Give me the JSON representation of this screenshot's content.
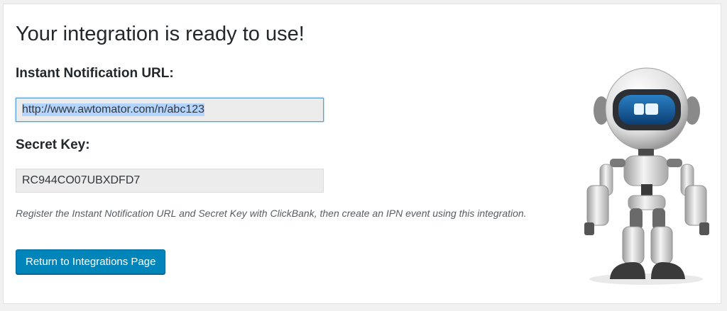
{
  "page": {
    "title": "Your integration is ready to use!"
  },
  "fields": {
    "notification_url": {
      "label": "Instant Notification URL:",
      "value": "http://www.awtomator.com/n/abc123"
    },
    "secret_key": {
      "label": "Secret Key:",
      "value": "RC944CO07UBXDFD7"
    }
  },
  "description": "Register the Instant Notification URL and Secret Key with ClickBank, then create an IPN event using this integration.",
  "actions": {
    "return_label": "Return to Integrations Page"
  },
  "colors": {
    "primary_button": "#0085ba",
    "focus_border": "#5b9dd9",
    "selection": "#b3d4fc"
  },
  "illustration": {
    "name": "robot-mascot"
  }
}
